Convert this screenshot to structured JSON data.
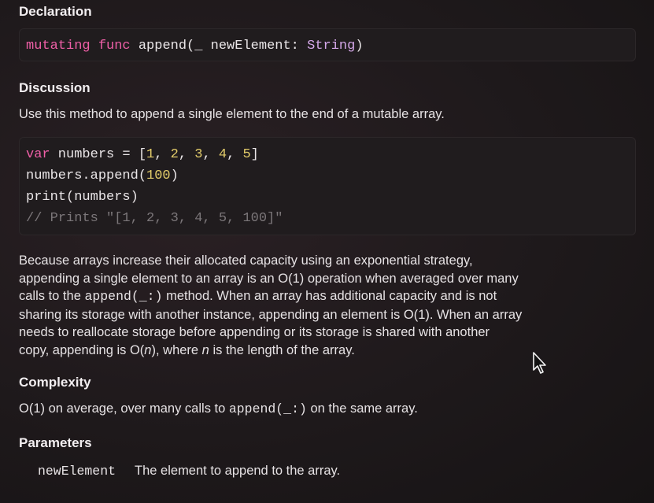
{
  "declaration": {
    "heading": "Declaration",
    "code": {
      "kw1": "mutating",
      "kw2": "func",
      "name": "append(_ newElement: ",
      "type": "String",
      "close": ")"
    }
  },
  "discussion": {
    "heading": "Discussion",
    "intro": "Use this method to append a single element to the end of a mutable array.",
    "code": {
      "line1": {
        "kw": "var",
        "pre": " numbers = [",
        "n1": "1",
        "sep1": ", ",
        "n2": "2",
        "sep2": ", ",
        "n3": "3",
        "sep3": ", ",
        "n4": "4",
        "sep4": ", ",
        "n5": "5",
        "post": "]"
      },
      "line2": {
        "pre": "numbers.append(",
        "num": "100",
        "post": ")"
      },
      "line3": "print(numbers)",
      "line4": "// Prints \"[1, 2, 3, 4, 5, 100]\""
    },
    "body": {
      "line1": "Because arrays increase their allocated capacity using an exponential strategy,",
      "line2": "appending a single element to an array is an O(1) operation when averaged over many",
      "line3_pre": "calls to the ",
      "line3_code": "append(_:)",
      "line3_post": " method. When an array has additional capacity and is not",
      "line4": "sharing its storage with another instance, appending an element is O(1). When an array",
      "line5": "needs to reallocate storage before appending or its storage is shared with another",
      "line6_pre": "copy, appending is O(",
      "line6_n": "n",
      "line6_mid": "), where ",
      "line6_n2": "n",
      "line6_post": " is the length of the array."
    }
  },
  "complexity": {
    "heading": "Complexity",
    "pre": "O(1) on average, over many calls to ",
    "code": "append(_:)",
    "post": " on the same array."
  },
  "parameters": {
    "heading": "Parameters",
    "items": [
      {
        "name": "newElement",
        "description": "The element to append to the array."
      }
    ]
  },
  "cursor": {
    "icon": "mouse-pointer-icon"
  }
}
